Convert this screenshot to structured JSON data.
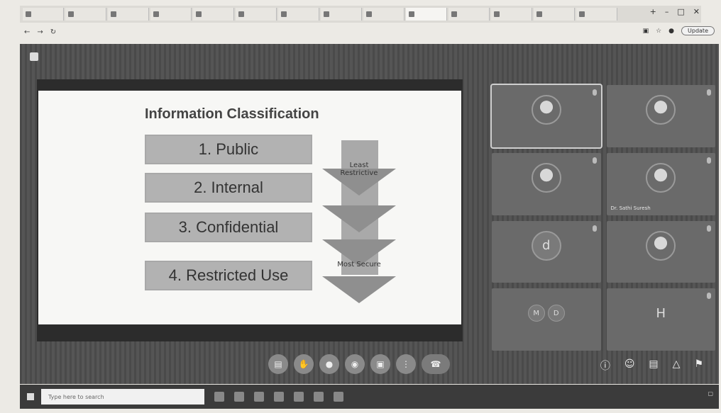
{
  "browser": {
    "tabs": [
      "",
      "",
      "",
      "",
      "",
      "",
      "",
      "",
      "",
      "",
      "",
      "",
      "",
      ""
    ],
    "address": "",
    "update_label": "Update"
  },
  "meeting": {
    "title": "",
    "slide": {
      "title": "Information Classification",
      "levels": [
        "1. Public",
        "2. Internal",
        "3. Confidential",
        "4. Restricted Use"
      ],
      "arrow_top": "Least Restrictive",
      "arrow_bottom": "Most Secure"
    },
    "participants": [
      {
        "name": "",
        "kind": "photo"
      },
      {
        "name": "",
        "kind": "photo"
      },
      {
        "name": "",
        "kind": "photo"
      },
      {
        "name": "Dr. Sathi Suresh",
        "kind": "photo"
      },
      {
        "name": "",
        "kind": "letter",
        "letter": "d"
      },
      {
        "name": "",
        "kind": "photo"
      },
      {
        "name": "",
        "kind": "initials",
        "initials": [
          "M",
          "D"
        ]
      },
      {
        "name": "",
        "kind": "letter",
        "letter": "H"
      }
    ],
    "time_code": ""
  },
  "taskbar": {
    "search_placeholder": "Type here to search",
    "weather": "",
    "clock": ""
  }
}
